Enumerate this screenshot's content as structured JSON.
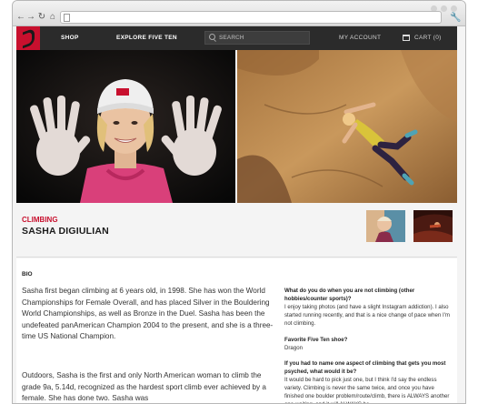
{
  "browser": {
    "url": ""
  },
  "header": {
    "nav": [
      "SHOP",
      "EXPLORE FIVE TEN"
    ],
    "search_placeholder": "SEARCH",
    "account": "MY ACCOUNT",
    "cart": "CART (0)"
  },
  "profile": {
    "category": "CLIMBING",
    "name": "SASHA DIGIULIAN"
  },
  "bio": {
    "label": "BIO",
    "paragraphs": [
      "Sasha first began climbing at 6 years old, in 1998. She has won the World Championships for Female Overall, and has placed Silver in the Bouldering World Championships, as well as Bronze in the Duel. Sasha has been the undefeated panAmerican Champion 2004 to the present, and she is a three-time US National Champion.",
      "Outdoors, Sasha is the first and only North American woman to climb the grade 9a, 5.14d, recognized as the hardest sport climb ever achieved by a female. She has done two. Sasha was"
    ]
  },
  "qa": [
    {
      "q": "What do you do when you are not climbing (other hobbies/counter sports)?",
      "a": "I enjoy taking photos (and have a slight Instagram addiction). I also started running recently, and that is a nice change of pace when I'm not climbing."
    },
    {
      "q": "Favorite Five Ten shoe?",
      "a": "Dragon"
    },
    {
      "q": "If you had to name one aspect of climbing that gets you most psyched, what would it be?",
      "a": "It would be hard to pick just one, but I think I'd say the endless variety. Climbing is never the same twice, and once you have finished one boulder problem/route/climb, there is ALWAYS another one waiting, and it will ALWAYS be"
    }
  ],
  "colors": {
    "accent": "#c8102e",
    "header_bg": "#2b2b2b"
  }
}
